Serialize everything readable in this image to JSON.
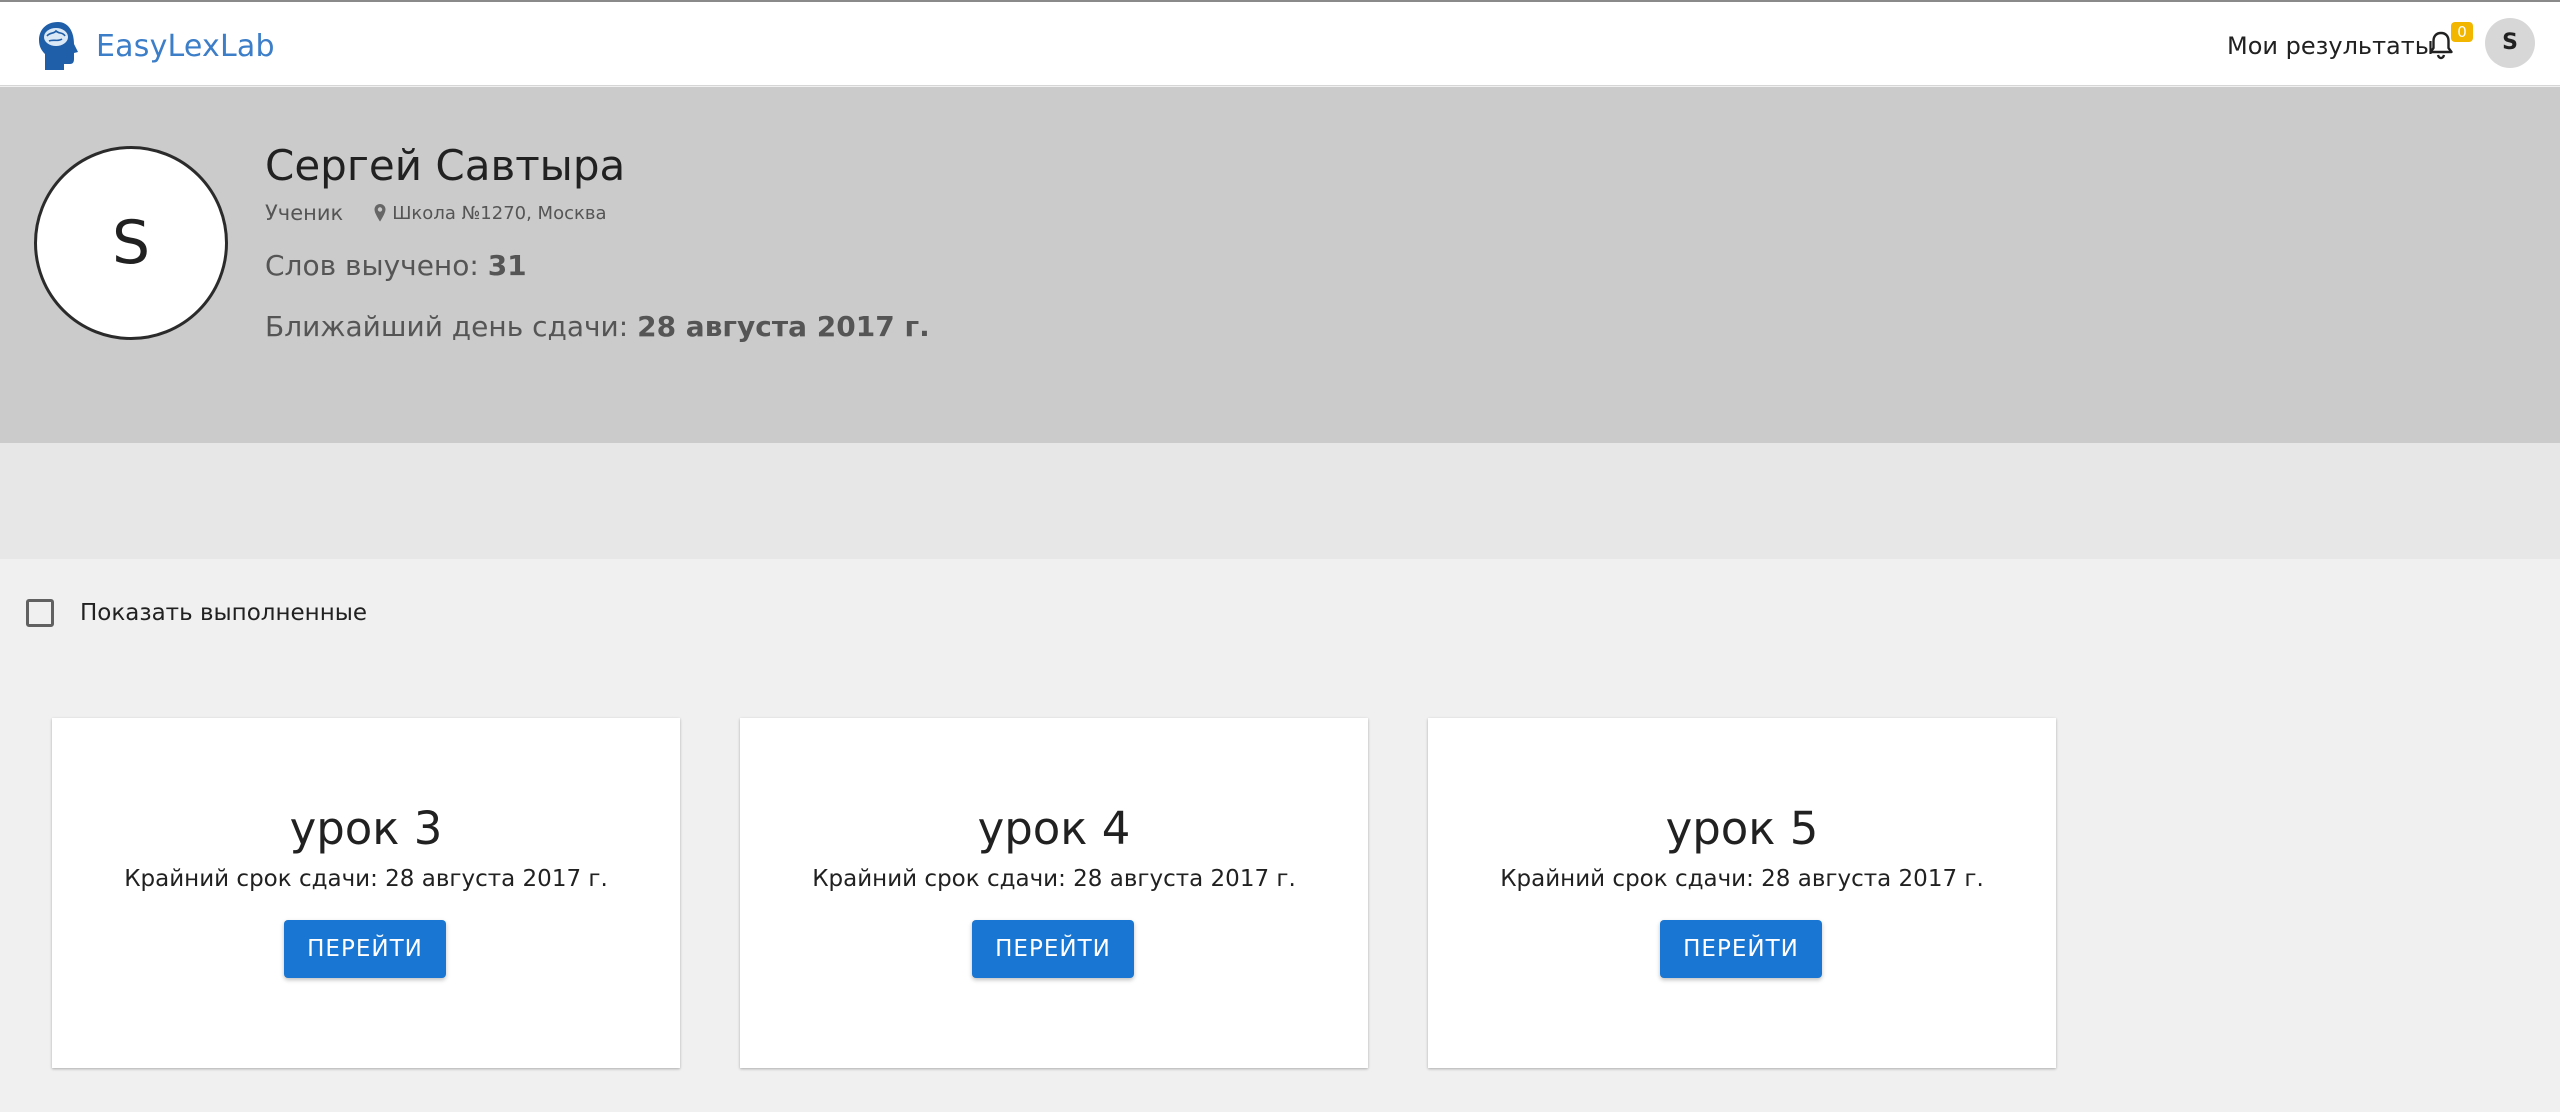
{
  "header": {
    "app_name": "EasyLexLab",
    "logo_icon": "head-brain-logo",
    "nav_results": "Мои результаты",
    "notification_icon": "bell-icon",
    "notification_count": "0",
    "user_initial": "S",
    "colors": {
      "brand": "#3d7ec8",
      "badge": "#f2b600"
    }
  },
  "profile": {
    "avatar_initial": "S",
    "name": "Сергей Савтыра",
    "role": "Ученик",
    "location_icon": "map-pin-icon",
    "school": "Школа №1270, Москва",
    "words_label": "Слов выучено: ",
    "words_count": "31",
    "deadline_label": "Ближайший день сдачи: ",
    "deadline_date": "28 августа 2017 г.",
    "colors": {
      "background": "#cbcbcb"
    }
  },
  "filter": {
    "label": "Показать выполненные",
    "checked": false
  },
  "lessons": [
    {
      "title": "урок 3",
      "deadline": "Крайний срок сдачи: 28 августа 2017 г.",
      "button": "ПЕРЕЙТИ"
    },
    {
      "title": "урок 4",
      "deadline": "Крайний срок сдачи: 28 августа 2017 г.",
      "button": "ПЕРЕЙТИ"
    },
    {
      "title": "урок 5",
      "deadline": "Крайний срок сдачи: 28 августа 2017 г.",
      "button": "ПЕРЕЙТИ"
    }
  ],
  "colors": {
    "button": "#1976d2",
    "page_background": "#f0f0f0"
  }
}
